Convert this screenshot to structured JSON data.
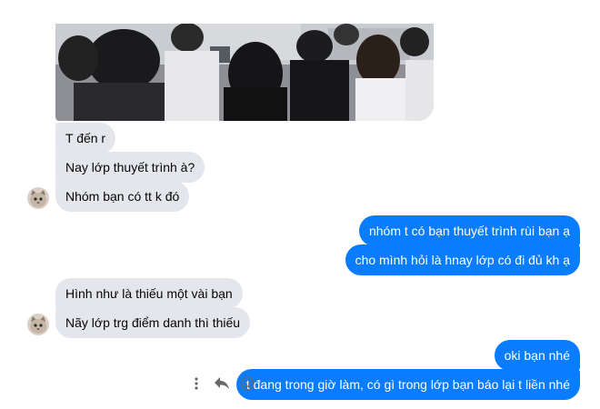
{
  "messages": {
    "in_1": "T đến r",
    "in_2": "Nay lớp thuyết trình à?",
    "in_3": "Nhóm bạn có tt k đó",
    "out_1": "nhóm t có bạn thuyết trình rùi bạn ạ",
    "out_2": "cho mình hỏi là hnay lớp có đi đủ kh ạ",
    "in_4": "Hình như là thiếu một vài bạn",
    "in_5": "Nãy lớp trg điểm danh thì thiếu",
    "out_3": "oki bạn nhé",
    "out_4": "t đang trong giờ làm, có gì trong lớp bạn báo lại t liền nhé"
  },
  "icons": {
    "more": "more-vertical-icon",
    "reply": "reply-icon",
    "react": "smiley-icon"
  },
  "colors": {
    "incoming_bubble": "#e4e6eb",
    "outgoing_bubble": "#0a7cff"
  }
}
